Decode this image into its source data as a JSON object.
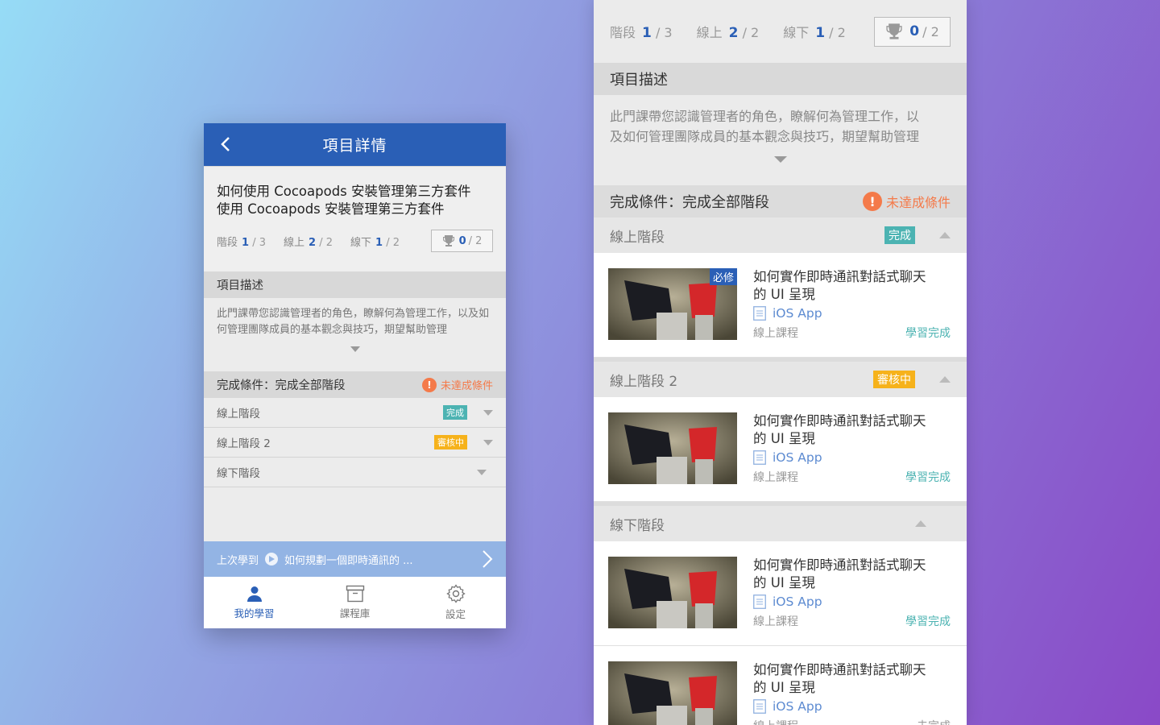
{
  "phone": {
    "nav_title": "項目詳情",
    "course_title_line1": "如何使用 Cocoapods 安裝管理第三方套件",
    "course_title_line2": "使用 Cocoapods 安裝管理第三方套件",
    "stats": [
      {
        "label": "階段",
        "num": "1",
        "den": "/ 3"
      },
      {
        "label": "線上",
        "num": "2",
        "den": "/ 2"
      },
      {
        "label": "線下",
        "num": "1",
        "den": "/ 2"
      }
    ],
    "trophy": {
      "num": "0",
      "den": "/ 2"
    },
    "desc_title": "項目描述",
    "desc_text": "此門課帶您認識管理者的角色，瞭解何為管理工作，以及如何管理團隊成員的基本觀念與技巧，期望幫助管理",
    "condition": "完成條件：完成全部階段",
    "warning": "未達成條件",
    "stages": [
      {
        "label": "線上階段",
        "badge": "完成",
        "badge_type": "done"
      },
      {
        "label": "線上階段 2",
        "badge": "審核中",
        "badge_type": "review"
      },
      {
        "label": "線下階段",
        "badge": "",
        "badge_type": ""
      }
    ],
    "last_learned_label": "上次學到",
    "last_learned_title": "如何規劃一個即時通訊的 ...",
    "tabs": [
      {
        "label": "我的學習",
        "icon": "person-icon",
        "active": true
      },
      {
        "label": "課程庫",
        "icon": "archive-icon",
        "active": false
      },
      {
        "label": "設定",
        "icon": "gear-icon",
        "active": false
      }
    ]
  },
  "panel": {
    "stats": [
      {
        "label": "階段",
        "num": "1",
        "den": "/ 3"
      },
      {
        "label": "線上",
        "num": "2",
        "den": "/ 2"
      },
      {
        "label": "線下",
        "num": "1",
        "den": "/ 2"
      }
    ],
    "trophy": {
      "num": "0",
      "den": "/ 2"
    },
    "desc_title": "項目描述",
    "desc_line1": "此門課帶您認識管理者的角色，瞭解何為管理工作，以",
    "desc_line2": "及如何管理團隊成員的基本觀念與技巧，期望幫助管理",
    "condition": "完成條件：完成全部階段",
    "warning": "未達成條件",
    "stages": [
      {
        "label": "線上階段",
        "badge": "完成",
        "badge_type": "done",
        "cards": [
          {
            "title_line1": "如何實作即時通訊對話式聊天",
            "title_line2": "的 UI 呈現",
            "platform": "iOS App",
            "type": "線上課程",
            "status": "學習完成",
            "required": "必修"
          }
        ]
      },
      {
        "label": "線上階段 2",
        "badge": "審核中",
        "badge_type": "review",
        "cards": [
          {
            "title_line1": "如何實作即時通訊對話式聊天",
            "title_line2": "的 UI 呈現",
            "platform": "iOS App",
            "type": "線上課程",
            "status": "學習完成",
            "required": ""
          }
        ]
      },
      {
        "label": "線下階段",
        "badge": "",
        "badge_type": "",
        "cards": [
          {
            "title_line1": "如何實作即時通訊對話式聊天",
            "title_line2": "的 UI 呈現",
            "platform": "iOS App",
            "type": "線上課程",
            "status": "學習完成",
            "required": ""
          },
          {
            "title_line1": "如何實作即時通訊對話式聊天",
            "title_line2": "的 UI 呈現",
            "platform": "iOS App",
            "type": "線上課程",
            "status": "未完成",
            "required": ""
          }
        ]
      }
    ]
  },
  "colors": {
    "primary": "#2a5fb6",
    "done_badge": "#4cb3b2",
    "review_badge": "#f6b21b",
    "warning": "#f47a4a"
  }
}
